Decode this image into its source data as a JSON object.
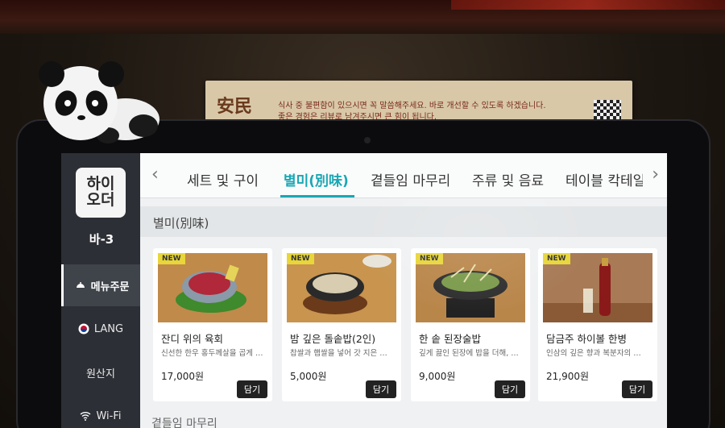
{
  "notice": {
    "logo_text": "安民",
    "line1": "식사 중 불편함이 있으시면 꼭 말씀해주세요. 바로 개선할 수 있도록 하겠습니다.",
    "line2": "좋은 경험은 리뷰로 남겨주시면 큰 힘이 됩니다."
  },
  "sidebar": {
    "brand": "하이\n오더",
    "table_name": "바-3",
    "items": [
      {
        "label": "메뉴주문",
        "icon": "cloche-icon",
        "active": true
      },
      {
        "label": "LANG",
        "icon": "korea-flag-icon",
        "active": false
      },
      {
        "label": "원산지",
        "icon": "",
        "active": false
      },
      {
        "label": "Wi-Fi",
        "icon": "wifi-icon",
        "active": false
      }
    ]
  },
  "tabs": [
    {
      "label": "세트 및 구이",
      "active": false
    },
    {
      "label": "별미(別味)",
      "active": true
    },
    {
      "label": "곁들임 마무리",
      "active": false
    },
    {
      "label": "주류 및 음료",
      "active": false
    },
    {
      "label": "테이블 칵테일",
      "active": false
    }
  ],
  "section": {
    "title": "별미(別味)",
    "next_title": "곁들임 마무리"
  },
  "cards": [
    {
      "badge": "NEW",
      "name": "잔디 위의 육회",
      "desc": "신선한 한우 홍두께살을 곱게 …",
      "price": "17,000원",
      "button": "담기",
      "photo": "yukhoe-photo"
    },
    {
      "badge": "NEW",
      "name": "밤 깊은 돌솥밥(2인)",
      "desc": "찹쌀과 햅쌀을 넣어 갓 지은 …",
      "price": "5,000원",
      "button": "담기",
      "photo": "dolsotbap-photo"
    },
    {
      "badge": "NEW",
      "name": "한 솥 된장술밥",
      "desc": "깊게 끓인 된장에 밥을 더해, …",
      "price": "9,000원",
      "button": "담기",
      "photo": "doenjang-photo"
    },
    {
      "badge": "NEW",
      "name": "담금주 하이볼 한병",
      "desc": "인삼의 깊은 향과 복분자의 …",
      "price": "21,900원",
      "button": "담기",
      "photo": "highball-photo"
    }
  ],
  "colors": {
    "accent": "#1aa7b4",
    "badge": "#e8d63a",
    "button": "#222222"
  }
}
